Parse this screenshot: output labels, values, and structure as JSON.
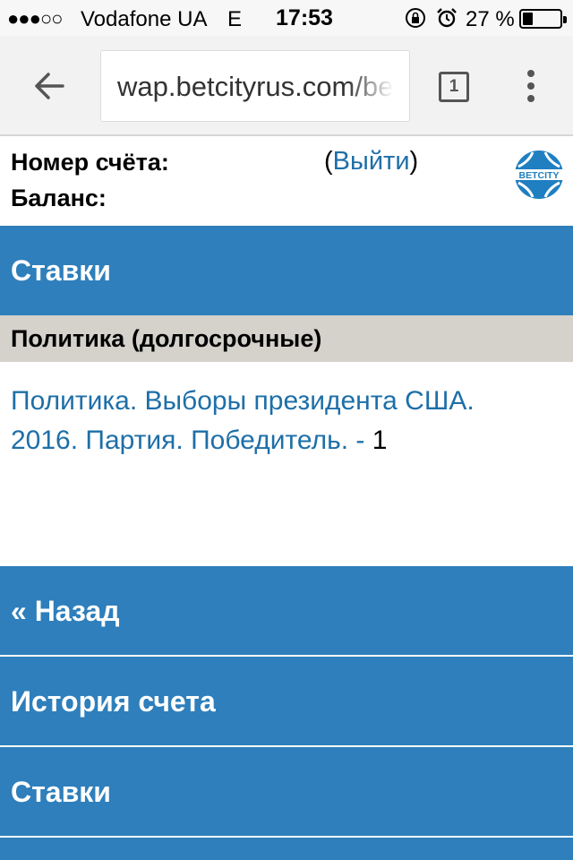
{
  "status_bar": {
    "signal": "●●●○○",
    "carrier": "Vodafone UA",
    "network": "E",
    "time": "17:53",
    "battery_percent": "27 %",
    "battery_level": 0.27,
    "icons": [
      "rotation-lock-icon",
      "alarm-icon",
      "battery-icon"
    ]
  },
  "browser": {
    "url": "wap.betcityrus.com/be",
    "tab_count": "1",
    "icons": [
      "back-arrow-icon",
      "tabs-icon",
      "more-vert-icon"
    ]
  },
  "account": {
    "account_label": "Номер счёта:",
    "balance_label": "Баланс:",
    "logout_open": "(",
    "logout_label": "Выйти",
    "logout_close": ")",
    "logo_text": "BETCITY"
  },
  "section_title": "Ставки",
  "category": "Политика (долгосрочные)",
  "event": {
    "link_text": "Политика. Выборы президента США. 2016. Партия. Победитель. -",
    "count": " 1"
  },
  "nav": {
    "back": "« Назад",
    "history": "История счета",
    "bets": "Ставки"
  },
  "colors": {
    "accent_blue": "#2e7fbb",
    "link_blue": "#1e6fa8",
    "category_bg": "#d5d2cc"
  }
}
